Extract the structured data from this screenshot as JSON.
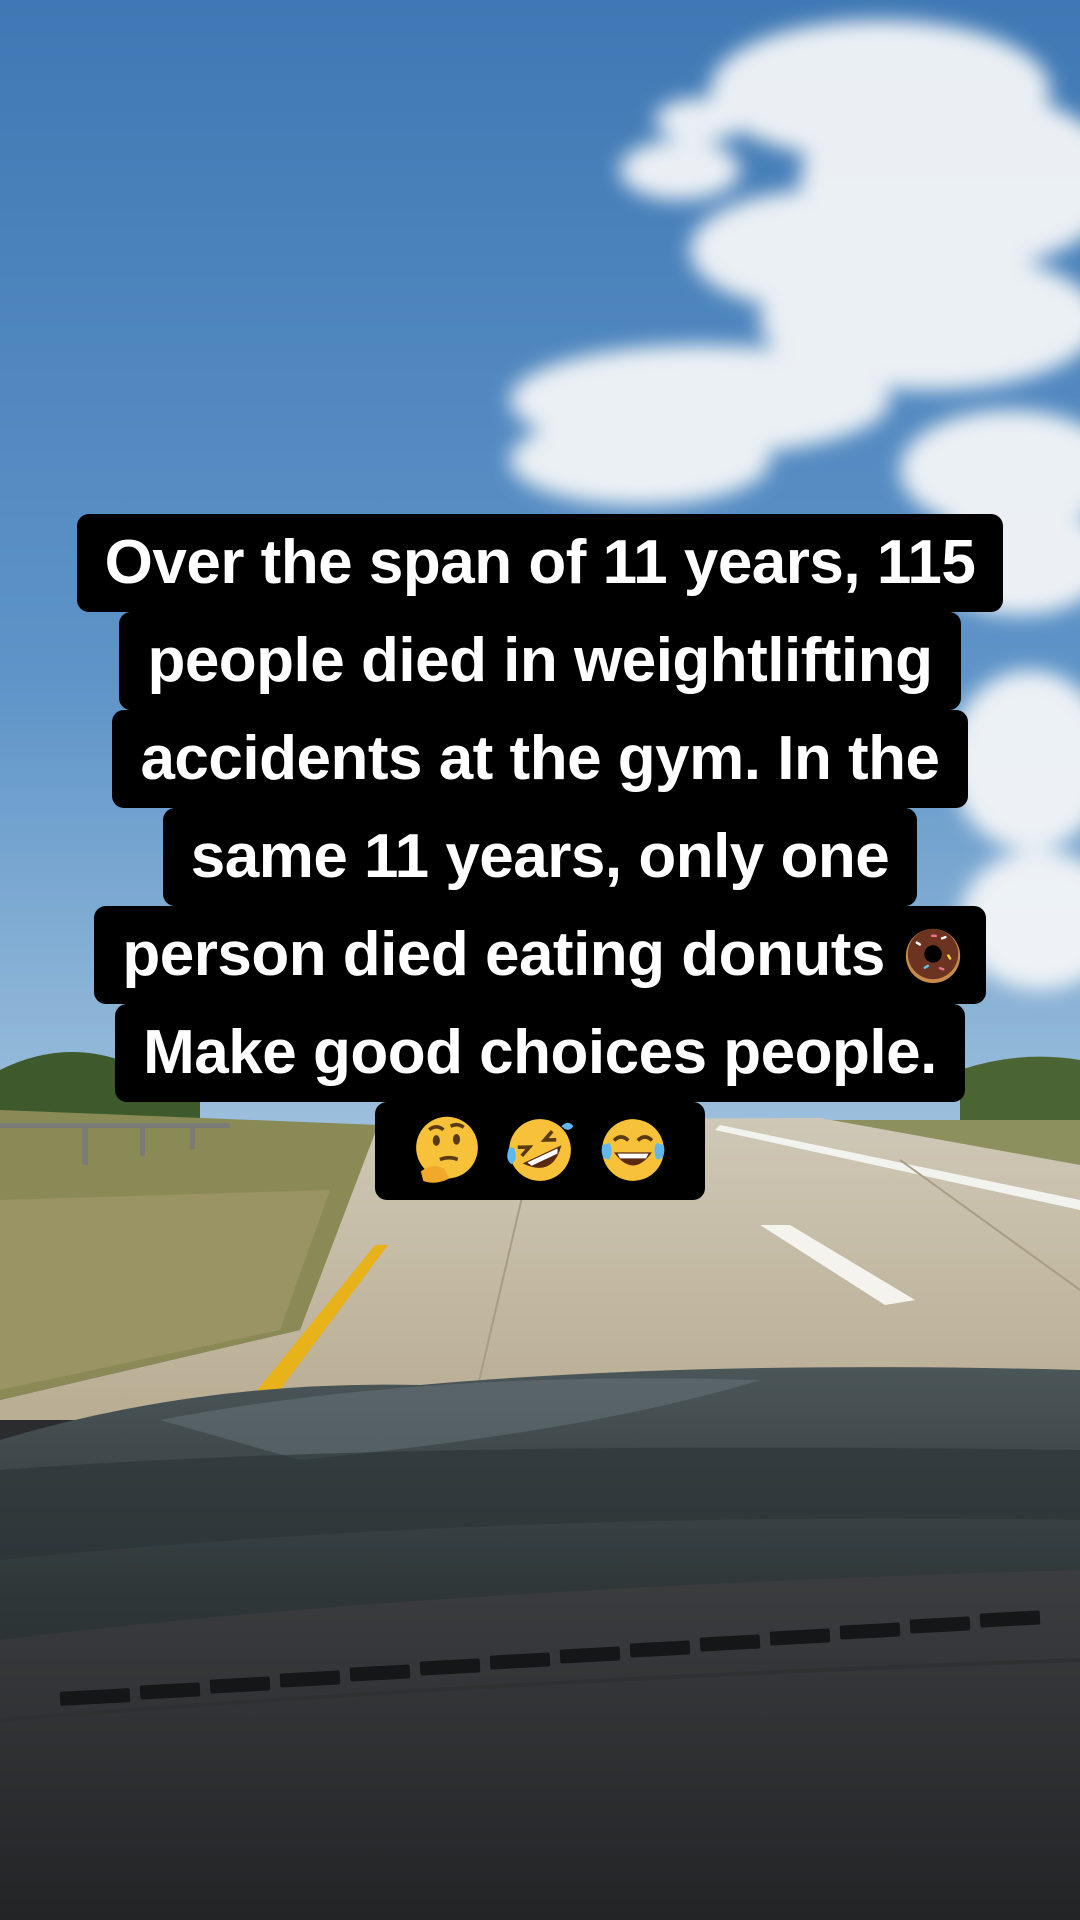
{
  "caption": {
    "lines": [
      "Over the span of 11 years, 115",
      "people died in weightlifting",
      "accidents at the gym. In the",
      "same 11 years, only one",
      "person died eating donuts",
      "Make good choices people."
    ]
  },
  "emojis": [
    "donut-emoji",
    "thinking-face-emoji",
    "rolling-on-floor-laughing-emoji",
    "tears-of-joy-emoji"
  ],
  "colors": {
    "sky": "#4f87c0",
    "caption_background": "#000000",
    "caption_text": "#ffffff",
    "center_line": "#e8b21a"
  }
}
